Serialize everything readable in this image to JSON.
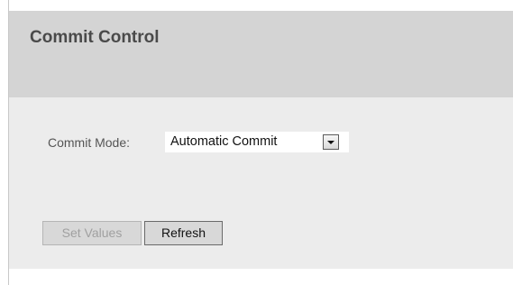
{
  "header": {
    "title": "Commit Control"
  },
  "form": {
    "commit_mode_label": "Commit Mode:",
    "commit_mode_value": "Automatic Commit"
  },
  "buttons": {
    "set_values_label": "Set Values",
    "set_values_enabled": false,
    "refresh_label": "Refresh"
  },
  "colors": {
    "header_bg": "#d4d4d4",
    "content_bg": "#ececec",
    "title_text": "#4a4a4a"
  },
  "icons": {
    "select_arrow": "dropdown-arrow-icon"
  }
}
